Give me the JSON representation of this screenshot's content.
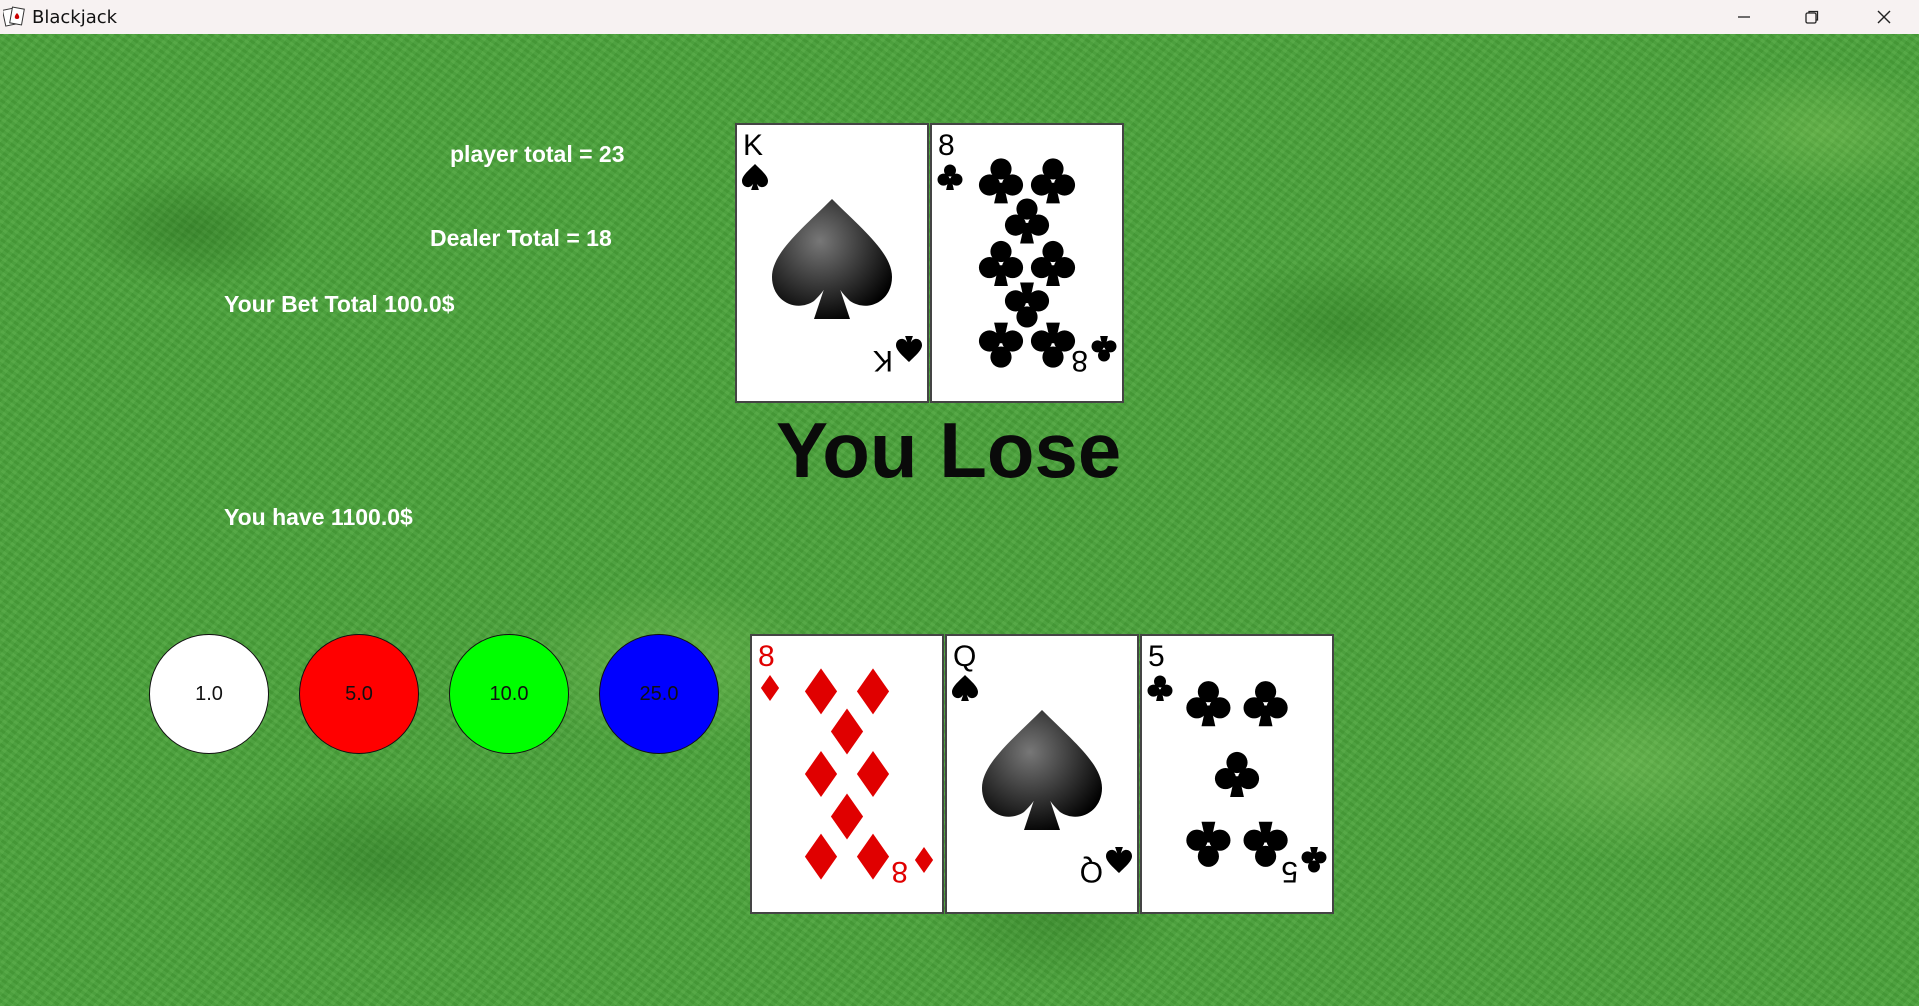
{
  "window": {
    "title": "Blackjack",
    "icons": {
      "app": "cards-app-icon",
      "minimize": "minimize-icon",
      "maximize": "restore-icon",
      "close": "close-icon"
    }
  },
  "stats": {
    "player_total": "player total = 23",
    "dealer_total": "Dealer Total = 18",
    "bet_total": "Your Bet Total 100.0$",
    "balance": "You have 1100.0$"
  },
  "result": "You Lose",
  "chips": [
    {
      "label": "1.0",
      "color": "#ffffff"
    },
    {
      "label": "5.0",
      "color": "#ff0000"
    },
    {
      "label": "10.0",
      "color": "#00ff00"
    },
    {
      "label": "25.0",
      "color": "#0000ff"
    }
  ],
  "dealer_hand": [
    {
      "rank": "K",
      "suit": "spades"
    },
    {
      "rank": "8",
      "suit": "clubs"
    }
  ],
  "player_hand": [
    {
      "rank": "8",
      "suit": "diamonds"
    },
    {
      "rank": "Q",
      "suit": "spades"
    },
    {
      "rank": "5",
      "suit": "clubs"
    }
  ],
  "colors": {
    "felt": "#4aa33a",
    "text": "#ffffff",
    "result_text": "#0a0a0a",
    "red_suit": "#e00000",
    "black_suit": "#000000"
  }
}
